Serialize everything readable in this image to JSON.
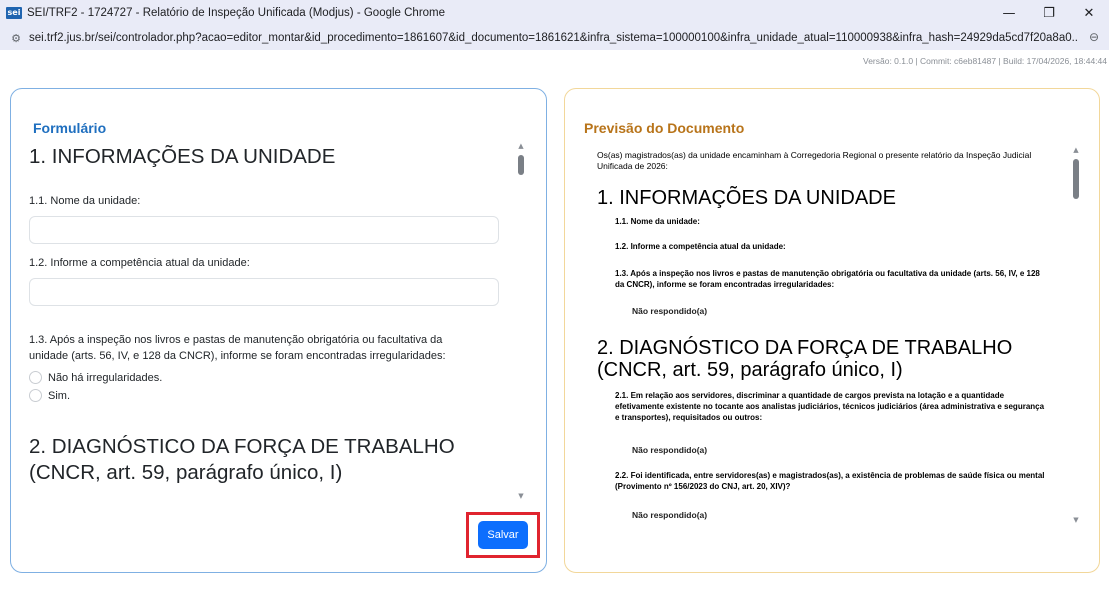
{
  "browser": {
    "favicon_text": "sei",
    "window_title": "SEI/TRF2 - 1724727 - Relatório de Inspeção Unificada (Modjus) - Google Chrome",
    "url": "sei.trf2.jus.br/sei/controlador.php?acao=editor_montar&id_procedimento=1861607&id_documento=1861621&infra_sistema=100000100&infra_unidade_atual=110000938&infra_hash=24929da5cd7f20a8a0...",
    "minimize_glyph": "—",
    "restore_glyph": "❐",
    "close_glyph": "✕",
    "site_icon_glyph": "⚙",
    "zoom_icon_glyph": "⊖"
  },
  "version_info": "Versão: 0.1.0 | Commit: c6eb81487 | Build: 17/04/2026, 18:44:44",
  "form": {
    "title": "Formulário",
    "section1": "1. INFORMAÇÕES DA UNIDADE",
    "q1_1_label": "1.1. Nome da unidade:",
    "q1_1_value": "",
    "q1_2_label": "1.2. Informe a competência atual da unidade:",
    "q1_2_value": "",
    "q1_3_label": "1.3. Após a inspeção nos livros e pastas de manutenção obrigatória ou facultativa da unidade (arts. 56, IV, e 128 da CNCR), informe se foram encontradas irregularidades:",
    "q1_3_options": [
      "Não há irregularidades.",
      "Sim."
    ],
    "section2": "2. DIAGNÓSTICO DA FORÇA DE TRABALHO (CNCR, art. 59, parágrafo único, I)",
    "save_label": "Salvar"
  },
  "preview": {
    "title": "Previsão do Documento",
    "intro": "Os(as) magistrados(as) da unidade encaminham à Corregedoria Regional o presente relatório da Inspeção Judicial Unificada de 2026:",
    "section1": "1. INFORMAÇÕES DA UNIDADE",
    "q1_1": "1.1. Nome da unidade:",
    "q1_2": "1.2. Informe a competência atual da unidade:",
    "q1_3": "1.3. Após a inspeção nos livros e pastas de manutenção obrigatória ou facultativa da unidade (arts. 56, IV, e 128 da CNCR), informe se foram encontradas irregularidades:",
    "a1_3": "Não respondido(a)",
    "section2": "2. DIAGNÓSTICO DA FORÇA DE TRABALHO (CNCR, art. 59, parágrafo único, I)",
    "q2_1": "2.1. Em relação aos servidores, discriminar a quantidade de cargos prevista na lotação e a quantidade efetivamente existente no tocante aos analistas judiciários, técnicos judiciários (área administrativa e segurança e transportes), requisitados ou outros:",
    "a2_1": "Não respondido(a)",
    "q2_2": "2.2. Foi identificada, entre servidores(as) e magistrados(as), a existência de problemas de saúde física ou mental (Provimento nº 156/2023 do CNJ, art. 20, XIV)?",
    "a2_2": "Não respondido(a)"
  },
  "colors": {
    "form_accent": "#1f6fbf",
    "preview_accent": "#b8741a",
    "save_button": "#0d6efd",
    "highlight": "#e0242f"
  }
}
